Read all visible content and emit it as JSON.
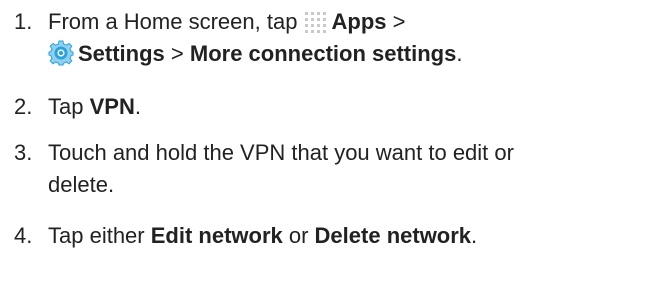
{
  "steps": [
    {
      "number": "1.",
      "line1_prefix": "From a Home screen, tap ",
      "apps_label": "Apps",
      "separator": " >",
      "settings_label": "Settings",
      "separator2": " > ",
      "more_label": "More connection settings",
      "suffix": "."
    },
    {
      "number": "2.",
      "prefix": "Tap ",
      "vpn_label": "VPN",
      "suffix": "."
    },
    {
      "number": "3.",
      "line1": "Touch and hold the VPN that you want to edit or",
      "line2": "delete."
    },
    {
      "number": "4.",
      "prefix": "Tap either ",
      "edit_label": "Edit network",
      "middle": " or ",
      "delete_label": "Delete network",
      "suffix": "."
    }
  ],
  "icons": {
    "apps": "apps-grid-icon",
    "settings": "settings-gear-icon"
  },
  "colors": {
    "text": "#222222",
    "apps_icon": "#c9c9c9",
    "gear_blue": "#2aa3dc",
    "gear_light": "#8fd0ef"
  }
}
